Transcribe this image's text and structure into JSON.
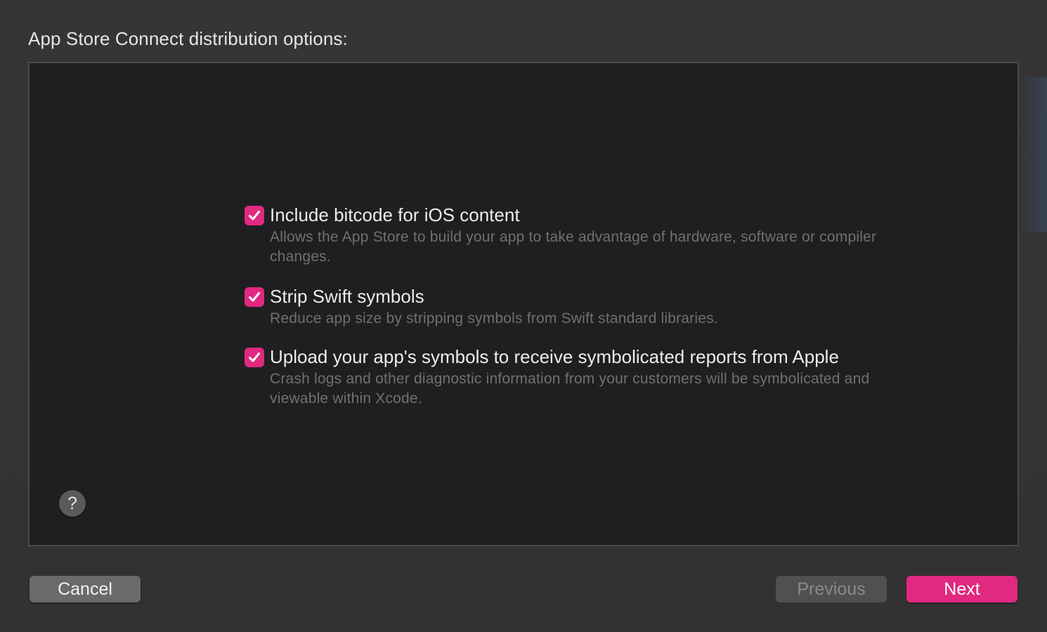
{
  "dialog": {
    "title": "App Store Connect distribution options:"
  },
  "options": [
    {
      "label": "Include bitcode for iOS content",
      "description": "Allows the App Store to build your app to take advantage of hardware, software or compiler changes.",
      "checked": true
    },
    {
      "label": "Strip Swift symbols",
      "description": "Reduce app size by stripping symbols from Swift standard libraries.",
      "checked": true
    },
    {
      "label": "Upload your app's symbols to receive symbolicated reports from Apple",
      "description": "Crash logs and other diagnostic information from your customers will be symbolicated and viewable within Xcode.",
      "checked": true
    }
  ],
  "help": {
    "glyph": "?",
    "icon": "question-mark-icon"
  },
  "buttons": {
    "cancel": "Cancel",
    "previous": "Previous",
    "next": "Next"
  },
  "colors": {
    "accent": "#e0297f",
    "background": "#323232",
    "content_background": "#1f1f21"
  }
}
